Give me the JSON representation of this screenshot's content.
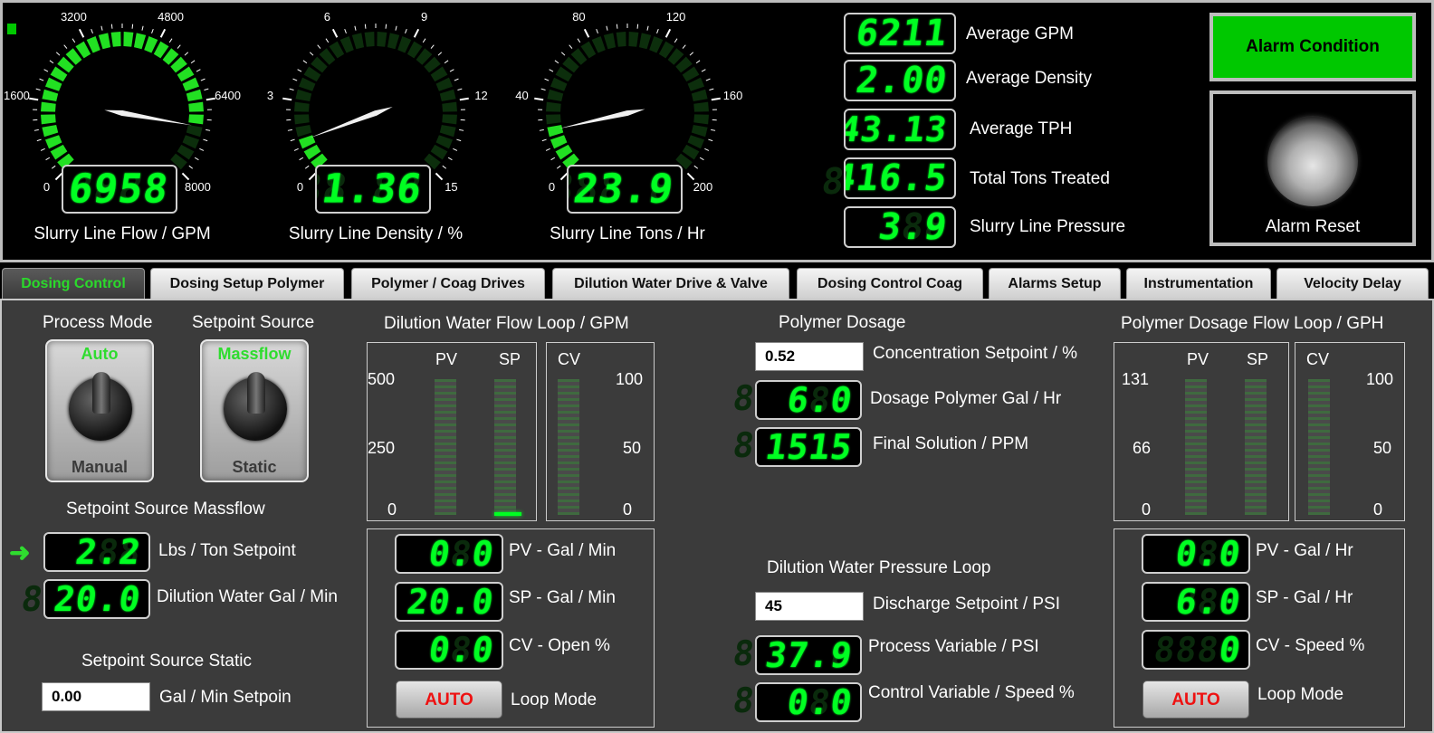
{
  "gauges": [
    {
      "label": "Slurry Line Flow / GPM",
      "value": "6958",
      "ghost": "8888",
      "ticks": [
        "0",
        "1600",
        "3200",
        "4800",
        "6400",
        "8000"
      ],
      "min": 0,
      "max": 8000,
      "reading": 6958
    },
    {
      "label": "Slurry Line Density / %",
      "value": "1.36",
      "ghost": "88.88",
      "ticks": [
        "0",
        "3",
        "6",
        "9",
        "12",
        "15"
      ],
      "min": 0,
      "max": 15,
      "reading": 1.36
    },
    {
      "label": "Slurry Line Tons / Hr",
      "value": "23.9",
      "ghost": "888.8",
      "ticks": [
        "0",
        "40",
        "80",
        "120",
        "160",
        "200"
      ],
      "min": 0,
      "max": 200,
      "reading": 23.9
    }
  ],
  "averages": [
    {
      "value": "6211",
      "label": "Average GPM"
    },
    {
      "value": "2.00",
      "label": "Average Density"
    },
    {
      "value": "43.13",
      "label": "Average TPH"
    },
    {
      "value": "416.5",
      "label": "Total Tons Treated"
    },
    {
      "value": "3.9",
      "label": "Slurry Line Pressure"
    }
  ],
  "alarm": {
    "condition": "Alarm Condition",
    "reset": "Alarm Reset"
  },
  "tabs": [
    "Dosing Control",
    "Dosing Setup Polymer",
    "Polymer / Coag Drives",
    "Dilution Water Drive & Valve",
    "Dosing Control Coag",
    "Alarms Setup",
    "Instrumentation",
    "Velocity Delay"
  ],
  "process_mode": {
    "title": "Process Mode",
    "top": "Auto",
    "bottom": "Manual"
  },
  "setpoint_source": {
    "title": "Setpoint Source",
    "top": "Massflow",
    "bottom": "Static"
  },
  "massflow": {
    "title": "Setpoint Source Massflow",
    "lbs_value": "2.2",
    "lbs_label": "Lbs / Ton Setpoint",
    "dil_value": "20.0",
    "dil_label": "Dilution Water Gal / Min"
  },
  "static": {
    "title": "Setpoint Source Static",
    "value": "0.00",
    "label": "Gal / Min Setpoin"
  },
  "dil_loop": {
    "title": "Dilution Water Flow Loop / GPM",
    "pv": "PV",
    "sp": "SP",
    "cv": "CV",
    "scale_left": [
      "500",
      "250",
      "0"
    ],
    "scale_right": [
      "100",
      "50",
      "0"
    ],
    "pv_value": "0.0",
    "pv_label": "PV - Gal / Min",
    "sp_value": "20.0",
    "sp_label": "SP - Gal / Min",
    "cv_value": "0.0",
    "cv_label": "CV - Open %",
    "mode": "AUTO",
    "mode_label": "Loop Mode"
  },
  "polymer_dosage": {
    "title": "Polymer Dosage",
    "conc_value": "0.52",
    "conc_label": "Concentration Setpoint / %",
    "dose_value": "6.0",
    "dose_label": "Dosage Polymer Gal / Hr",
    "final_value": "1515",
    "final_label": "Final Solution / PPM"
  },
  "pressure_loop": {
    "title": "Dilution Water Pressure Loop",
    "setpoint": "45",
    "setpoint_label": "Discharge Setpoint / PSI",
    "pv_value": "37.9",
    "pv_label": "Process Variable / PSI",
    "cv_value": "0.0",
    "cv_label": "Control Variable / Speed %"
  },
  "poly_loop": {
    "title": "Polymer Dosage Flow Loop / GPH",
    "pv": "PV",
    "sp": "SP",
    "cv": "CV",
    "scale_left": [
      "131",
      "66",
      "0"
    ],
    "scale_right": [
      "100",
      "50",
      "0"
    ],
    "pv_value": "0.0",
    "pv_label": "PV - Gal / Hr",
    "sp_value": "6.0",
    "sp_label": "SP - Gal / Hr",
    "cv_value": "0",
    "cv_label": "CV - Speed %",
    "mode": "AUTO",
    "mode_label": "Loop Mode"
  },
  "colors": {
    "led": "#00ff22",
    "alarm": "#00c800",
    "auto_text": "#e11111"
  }
}
